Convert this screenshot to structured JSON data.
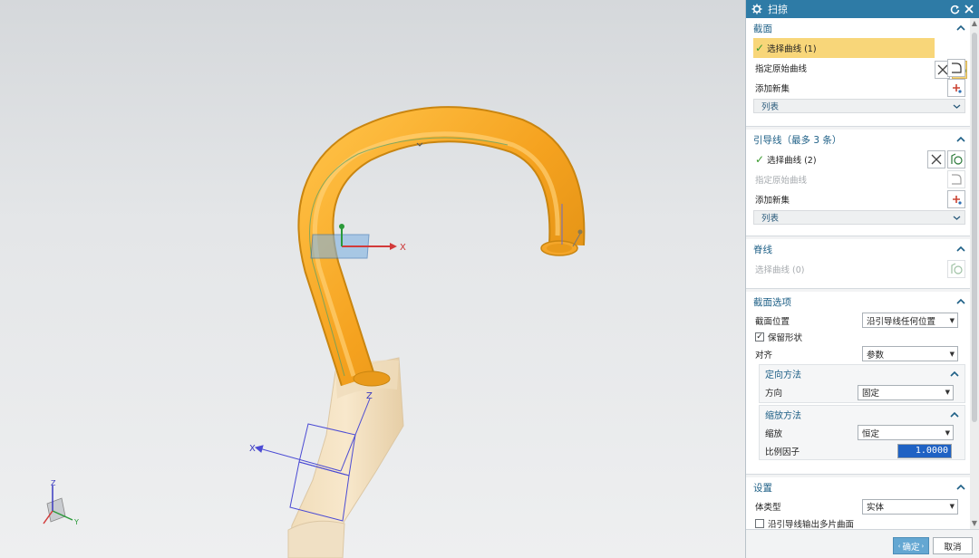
{
  "dialog": {
    "title": "扫掠",
    "reset_icon": "reset-icon",
    "close_icon": "close-icon"
  },
  "section": {
    "header": "截面",
    "select_curve": "选择曲线 (1)",
    "specify_origin": "指定原始曲线",
    "add_new_set": "添加新集",
    "list": "列表"
  },
  "guide": {
    "header": "引导线（最多 3 条）",
    "select_curve": "选择曲线 (2)",
    "specify_origin": "指定原始曲线",
    "add_new_set": "添加新集",
    "list": "列表"
  },
  "spine": {
    "header": "脊线",
    "select_curve": "选择曲线 (0)"
  },
  "section_options": {
    "header": "截面选项",
    "position_label": "截面位置",
    "position_value": "沿引导线任何位置",
    "preserve_shape": "保留形状",
    "alignment_label": "对齐",
    "alignment_value": "参数",
    "orientation": {
      "header": "定向方法",
      "direction_label": "方向",
      "direction_value": "固定"
    },
    "scaling": {
      "header": "缩放方法",
      "scale_label": "缩放",
      "scale_value": "恒定",
      "factor_label": "比例因子",
      "factor_value": "1.0000"
    }
  },
  "settings": {
    "header": "设置",
    "body_type_label": "体类型",
    "body_type_value": "实体",
    "multi_sheet": "沿引导线输出多片曲面"
  },
  "footer": {
    "ok": "确定",
    "cancel": "取消"
  },
  "viewport": {
    "axis_x": "X",
    "axis_y": "Y",
    "axis_z": "Z",
    "accent_color": "#f5a623",
    "highlight_color": "#f8d679"
  }
}
